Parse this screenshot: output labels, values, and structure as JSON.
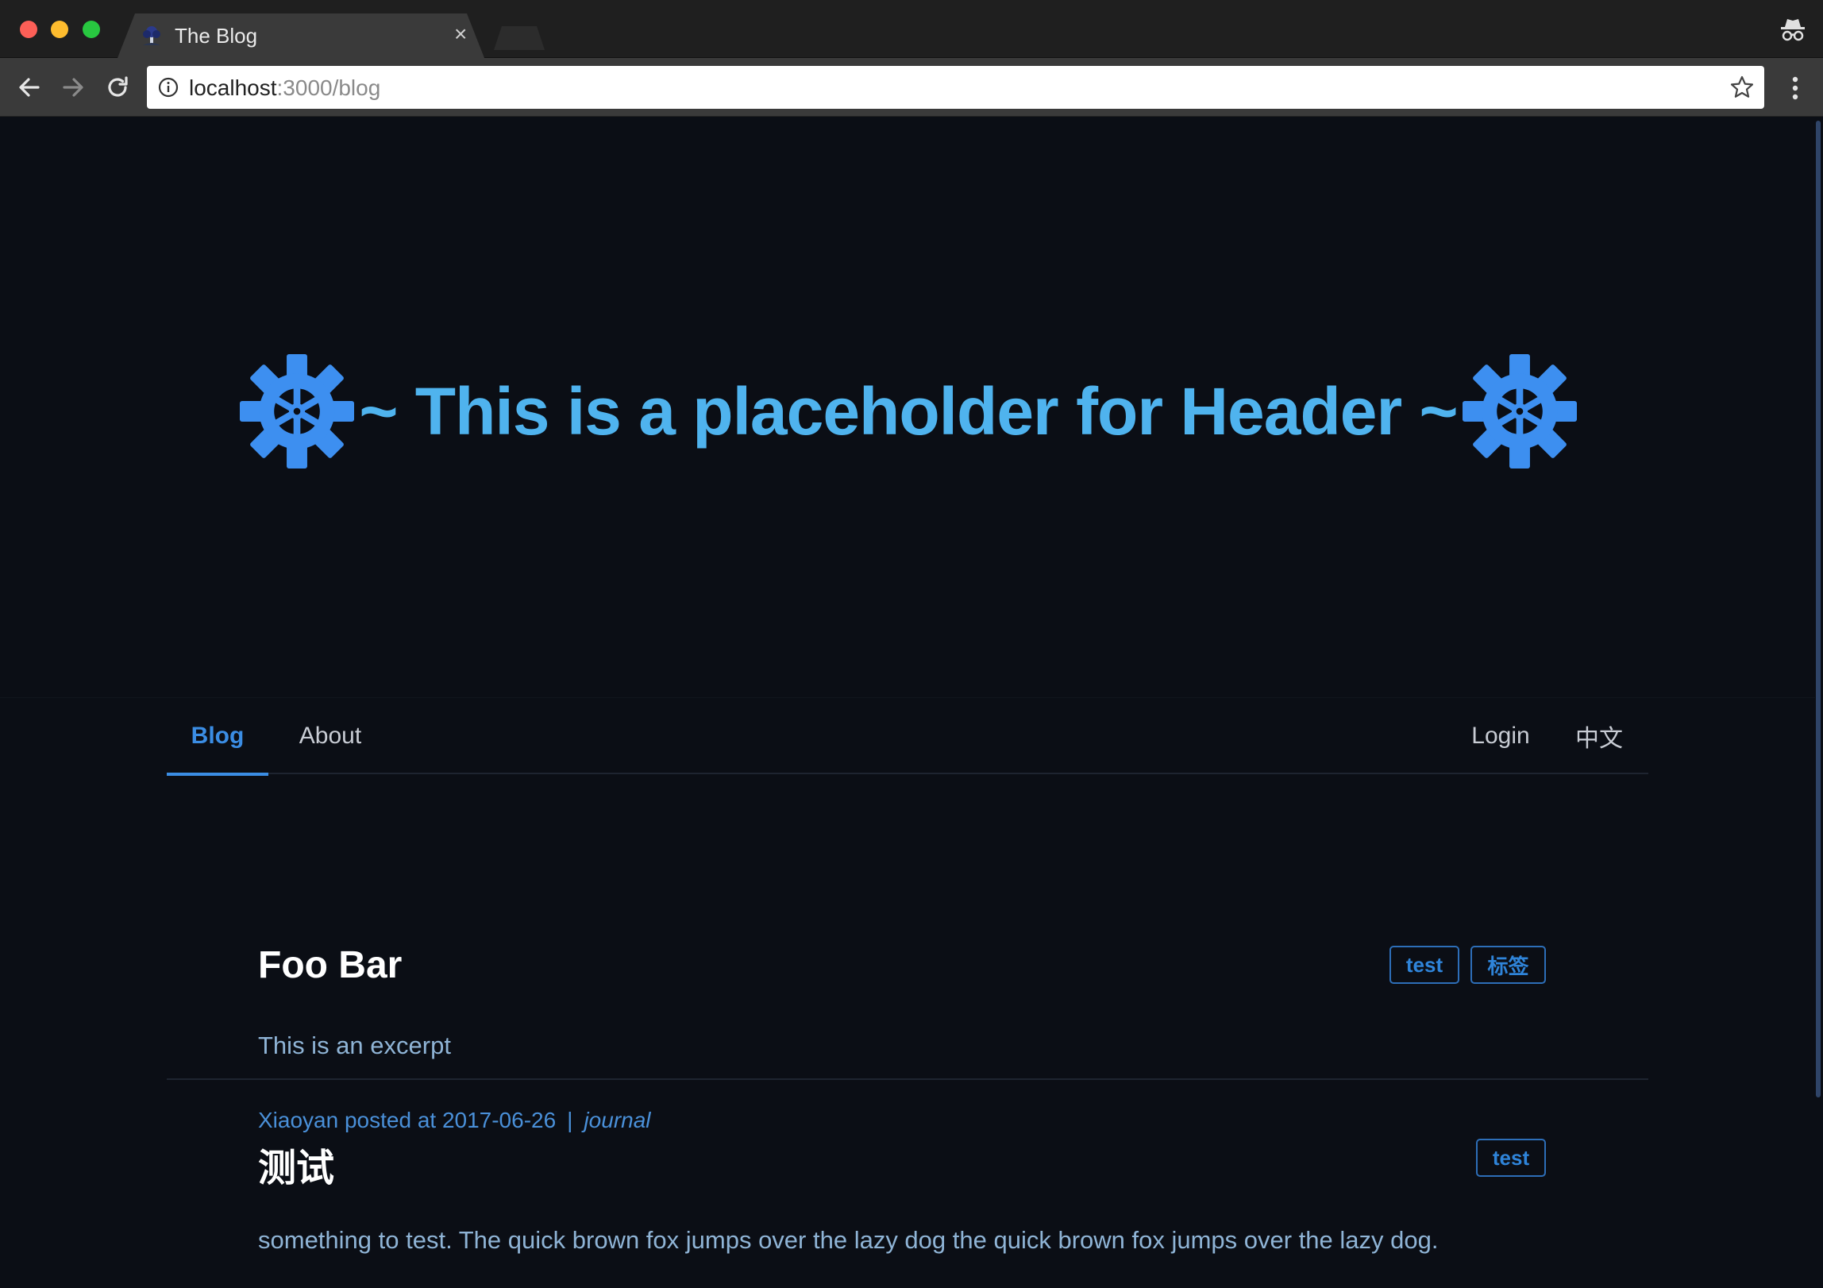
{
  "browser": {
    "tab_title": "The Blog",
    "tab_close": "×",
    "url_host": "localhost",
    "url_path": ":3000/blog"
  },
  "hero": {
    "title": "~ This is a placeholder for Header ~",
    "gear_color": "#3d8ff0",
    "title_color": "#4fb3ee"
  },
  "nav": {
    "left": [
      {
        "label": "Blog",
        "active": true
      },
      {
        "label": "About",
        "active": false
      }
    ],
    "right": [
      {
        "label": "Login"
      },
      {
        "label": "中文"
      }
    ]
  },
  "posts": [
    {
      "title": "Foo Bar",
      "tags": [
        "test",
        "标签"
      ],
      "excerpt": "This is an excerpt",
      "meta": "Xiaoyan posted at 2017-06-26",
      "separator": "|",
      "category": "journal"
    },
    {
      "title": "测试",
      "tags": [
        "test"
      ],
      "excerpt": "something to test. The quick brown fox jumps over the lazy dog the quick brown fox jumps over the lazy dog."
    }
  ],
  "colors": {
    "background": "#0b0e15",
    "accent": "#3b8de4",
    "tag_border": "#2d6eb8"
  }
}
